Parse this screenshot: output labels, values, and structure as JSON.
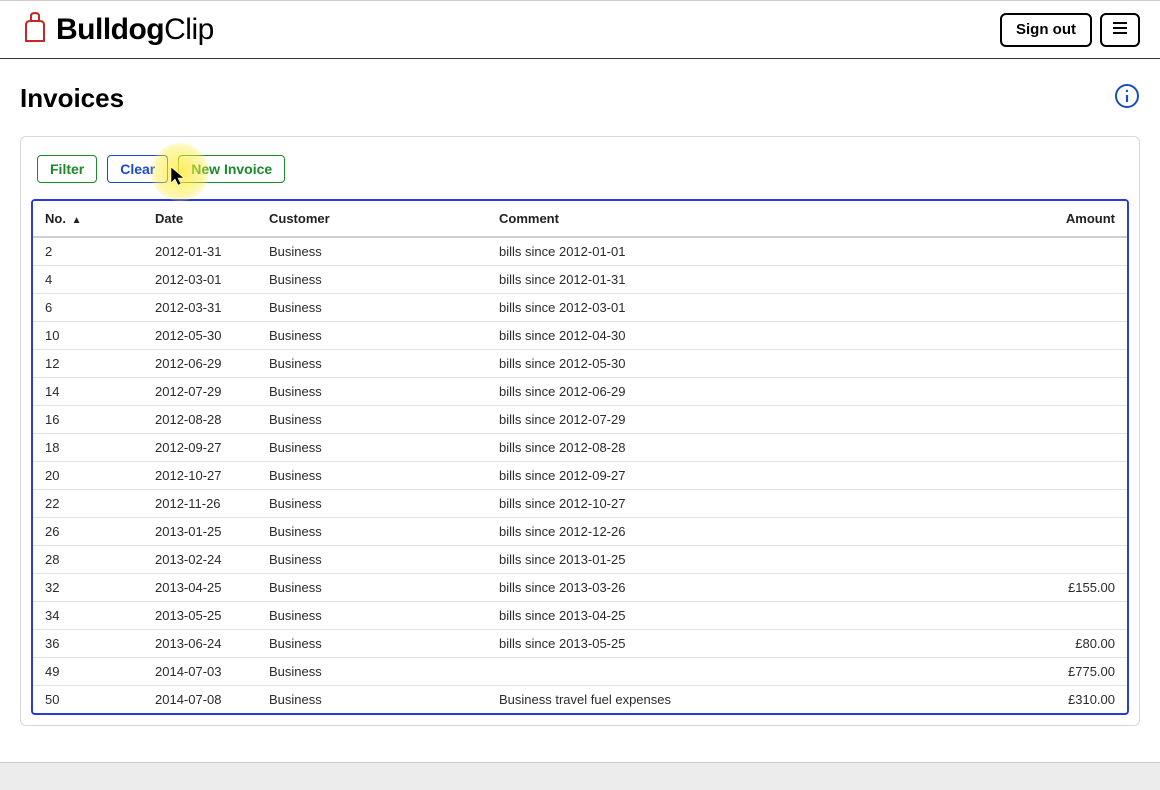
{
  "header": {
    "app_name_bold": "Bulldog",
    "app_name_light": "Clip",
    "signout_label": "Sign out"
  },
  "page": {
    "title": "Invoices"
  },
  "toolbar": {
    "filter_label": "Filter",
    "clear_label": "Clear",
    "new_invoice_label": "New Invoice"
  },
  "table": {
    "columns": {
      "no": "No.",
      "date": "Date",
      "customer": "Customer",
      "comment": "Comment",
      "amount": "Amount"
    },
    "rows": [
      {
        "no": "2",
        "date": "2012-01-31",
        "customer": "Business",
        "comment": "bills since 2012-01-01",
        "amount": ""
      },
      {
        "no": "4",
        "date": "2012-03-01",
        "customer": "Business",
        "comment": "bills since 2012-01-31",
        "amount": ""
      },
      {
        "no": "6",
        "date": "2012-03-31",
        "customer": "Business",
        "comment": "bills since 2012-03-01",
        "amount": ""
      },
      {
        "no": "10",
        "date": "2012-05-30",
        "customer": "Business",
        "comment": "bills since 2012-04-30",
        "amount": ""
      },
      {
        "no": "12",
        "date": "2012-06-29",
        "customer": "Business",
        "comment": "bills since 2012-05-30",
        "amount": ""
      },
      {
        "no": "14",
        "date": "2012-07-29",
        "customer": "Business",
        "comment": "bills since 2012-06-29",
        "amount": ""
      },
      {
        "no": "16",
        "date": "2012-08-28",
        "customer": "Business",
        "comment": "bills since 2012-07-29",
        "amount": ""
      },
      {
        "no": "18",
        "date": "2012-09-27",
        "customer": "Business",
        "comment": "bills since 2012-08-28",
        "amount": ""
      },
      {
        "no": "20",
        "date": "2012-10-27",
        "customer": "Business",
        "comment": "bills since 2012-09-27",
        "amount": ""
      },
      {
        "no": "22",
        "date": "2012-11-26",
        "customer": "Business",
        "comment": "bills since 2012-10-27",
        "amount": ""
      },
      {
        "no": "26",
        "date": "2013-01-25",
        "customer": "Business",
        "comment": "bills since 2012-12-26",
        "amount": ""
      },
      {
        "no": "28",
        "date": "2013-02-24",
        "customer": "Business",
        "comment": "bills since 2013-01-25",
        "amount": ""
      },
      {
        "no": "32",
        "date": "2013-04-25",
        "customer": "Business",
        "comment": "bills since 2013-03-26",
        "amount": "£155.00"
      },
      {
        "no": "34",
        "date": "2013-05-25",
        "customer": "Business",
        "comment": "bills since 2013-04-25",
        "amount": ""
      },
      {
        "no": "36",
        "date": "2013-06-24",
        "customer": "Business",
        "comment": "bills since 2013-05-25",
        "amount": "£80.00"
      },
      {
        "no": "49",
        "date": "2014-07-03",
        "customer": "Business",
        "comment": "",
        "amount": "£775.00"
      },
      {
        "no": "50",
        "date": "2014-07-08",
        "customer": "Business",
        "comment": "Business travel fuel expenses",
        "amount": "£310.00"
      }
    ]
  }
}
